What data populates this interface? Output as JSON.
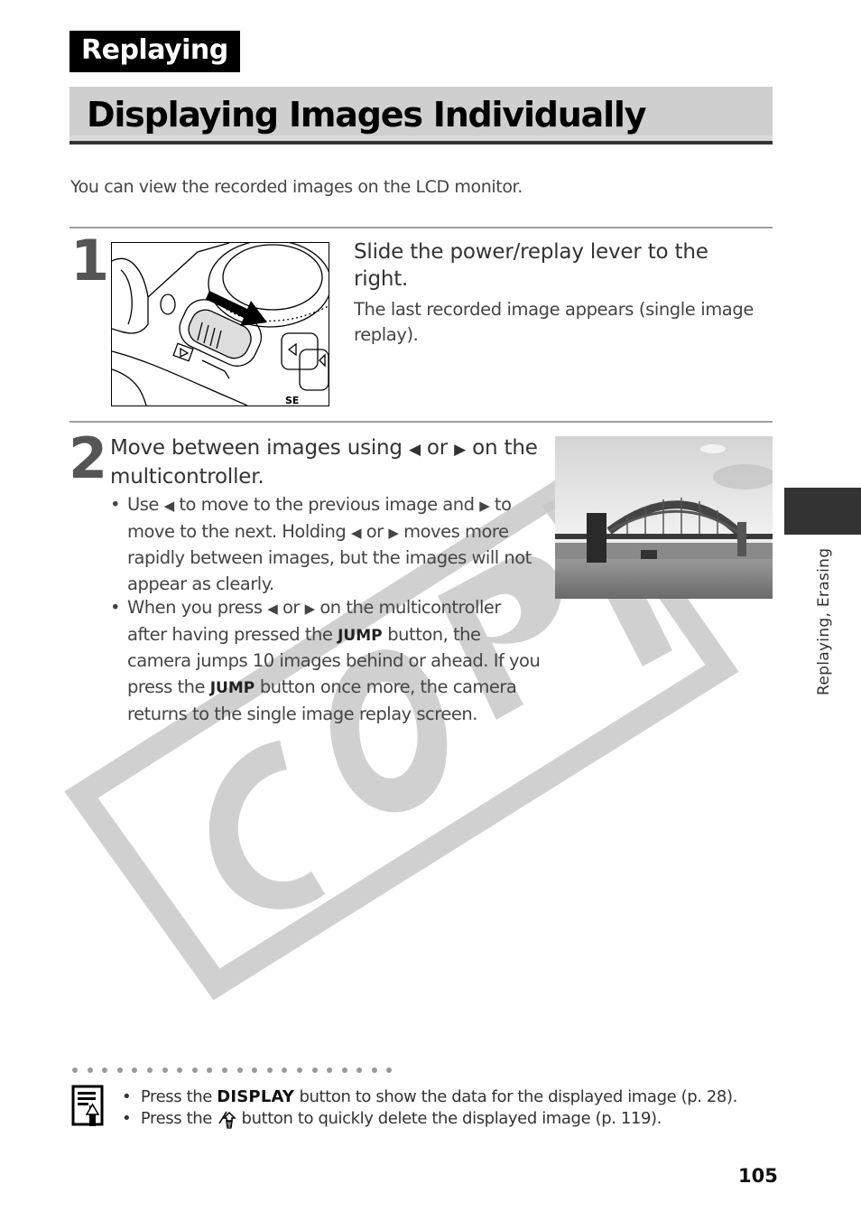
{
  "section": {
    "tag": "Replaying"
  },
  "page": {
    "title": "Displaying Images Individually",
    "intro": "You can view the recorded images on the LCD monitor.",
    "number": "105"
  },
  "steps": [
    {
      "number": "1",
      "heading": "Slide the power/replay lever to the right.",
      "description": "The last recorded image appears (single image replay).",
      "illustration": "camera-power-replay-lever-illustration"
    },
    {
      "number": "2",
      "heading_parts": [
        "Move between images using ",
        "◀",
        " or ",
        "▶",
        " on the multicontroller."
      ],
      "bullets": [
        {
          "parts": [
            "Use ",
            "◀",
            " to move to the previous image and ",
            "▶",
            " to move to the next. Holding ",
            "◀",
            " or ",
            "▶",
            " moves more rapidly between images, but the images will not appear as clearly."
          ]
        },
        {
          "parts": [
            "When you press ",
            "◀",
            " or ",
            "▶",
            " on the multicontroller after having pressed the ",
            "JUMP",
            " button, the camera jumps 10 images behind or ahead. If you press the ",
            "JUMP",
            " button once more, the camera returns to the single image replay screen."
          ]
        }
      ],
      "photo": "sydney-harbour-bridge-photo"
    }
  ],
  "side_tab": {
    "label": "Replaying, Erasing"
  },
  "watermark": {
    "text": "COPY",
    "color": "#c8c8c8"
  },
  "notes": {
    "icon": "memo-icon",
    "items": [
      {
        "pre": "Press the ",
        "key": "DISPLAY",
        "post": " button to show the data for the displayed image (p. 28)."
      },
      {
        "pre": "Press the ",
        "key_icon": "erase-button-icon",
        "post": " button to quickly delete the displayed image (p. 119)."
      }
    ],
    "bullet": "•"
  }
}
